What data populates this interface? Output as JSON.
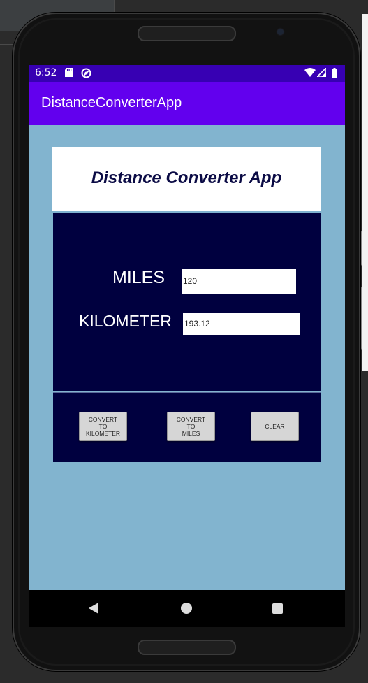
{
  "status_bar": {
    "time": "6:52"
  },
  "app_bar": {
    "title": "DistanceConverterApp"
  },
  "header": {
    "title": "Distance Converter App"
  },
  "form": {
    "miles_label": "MILES",
    "miles_value": "120",
    "kilometer_label": "KILOMETER",
    "kilometer_value": "193.12"
  },
  "buttons": {
    "to_km": "CONVERT\nTO\nKILOMETER",
    "to_miles": "CONVERT\nTO\nMILES",
    "clear": "CLEAR"
  },
  "colors": {
    "status_bar": "#3700b3",
    "app_bar": "#6200ee",
    "screen_bg": "#82b4cf",
    "panel_bg": "#00003f"
  },
  "icons": {
    "status_left": [
      "sd-card-icon",
      "sync-icon"
    ],
    "status_right": [
      "wifi-icon",
      "signal-icon",
      "battery-icon"
    ],
    "nav": [
      "back-icon",
      "home-icon",
      "recents-icon"
    ]
  }
}
